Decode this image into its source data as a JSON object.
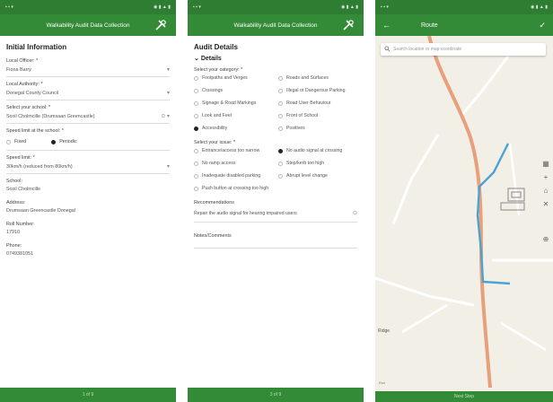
{
  "colors": {
    "primary": "#338a37",
    "status": "#2e7d32",
    "route": "#4ba3d3",
    "road": "#e8a07c"
  },
  "screen1": {
    "appbar_title": "Walkability Audit Data Collection",
    "section_title": "Initial Information",
    "fields": [
      {
        "label": "Local Officer: *",
        "value": "Fiona Barry",
        "dropdown": true
      },
      {
        "label": "Local Authority: *",
        "value": "Donegal County Council",
        "dropdown": true
      },
      {
        "label": "Select your school: *",
        "value": "Scoil Cholmcille (Drumsaan Greencastle)",
        "dropdown": true
      }
    ],
    "speed_label": "Speed limit at the school: *",
    "speed_options": [
      "Fixed",
      "Periodic"
    ],
    "speed_selected": "Periodic",
    "speed_limit_label": "Speed limit: *",
    "speed_limit_value": "30km/h (reduced from 80km/h)",
    "info": [
      {
        "label": "School:",
        "value": "Scoil Cholmcille"
      },
      {
        "label": "Address:",
        "value": "Drumsaan Greencastle Donegal"
      },
      {
        "label": "Roll Number:",
        "value": "17910"
      },
      {
        "label": "Phone:",
        "value": "0749381051"
      }
    ],
    "footer": "1 of 9"
  },
  "screen2": {
    "appbar_title": "Walkability Audit Data Collection",
    "section_title": "Audit Details",
    "subsection": "Details",
    "category_label": "Select your category: *",
    "categories": [
      "Footpaths and Verges",
      "Roads and Surfaces",
      "Crossings",
      "Illegal or Dangerous Parking",
      "Signage & Road Markings",
      "Road User Behaviour",
      "Look and Feel",
      "Front of School",
      "Accessibility",
      "Positives"
    ],
    "category_selected": "Accessibility",
    "issue_label": "Select your issue: *",
    "issues": [
      "Entrance/access too narrow",
      "No audio signal at crossing",
      "No ramp access",
      "Step/kerb too high",
      "Inadequate disabled parking",
      "Abrupt level change",
      "Push button at crossing too high"
    ],
    "issue_selected": "No audio signal at crossing",
    "recommendations_label": "Recommendations",
    "recommendations_value": "Repair the audio signal for hearing impaired users",
    "notes_label": "Notes/Comments",
    "footer": "3 of 9"
  },
  "screen3": {
    "appbar_title": "Route",
    "search_placeholder": "Search location or map coordinate",
    "labels": {
      "ridge": "Ridge",
      "map_attr": "Esri"
    },
    "footer": "Next Step"
  }
}
